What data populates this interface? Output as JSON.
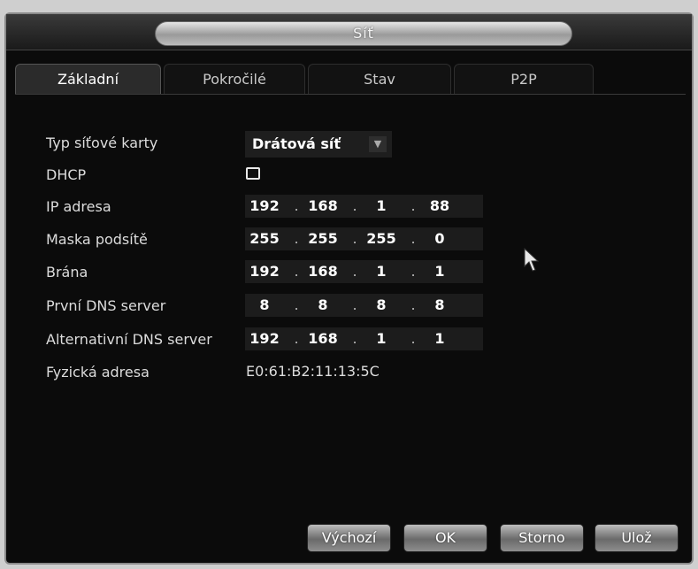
{
  "window": {
    "title": "Síť"
  },
  "tabs": [
    "Základní",
    "Pokročilé",
    "Stav",
    "P2P"
  ],
  "form": {
    "nic_type_label": "Typ síťové karty",
    "nic_type_value": "Drátová síť",
    "dhcp_label": "DHCP",
    "dhcp_checked": false,
    "ip_label": "IP adresa",
    "ip": [
      "192",
      "168",
      "1",
      "88"
    ],
    "mask_label": "Maska podsítě",
    "mask": [
      "255",
      "255",
      "255",
      "0"
    ],
    "gateway_label": "Brána",
    "gateway": [
      "192",
      "168",
      "1",
      "1"
    ],
    "dns1_label": "První DNS server",
    "dns1": [
      "8",
      "8",
      "8",
      "8"
    ],
    "dns2_label": "Alternativní DNS server",
    "dns2": [
      "192",
      "168",
      "1",
      "1"
    ],
    "mac_label": "Fyzická adresa",
    "mac": "E0:61:B2:11:13:5C"
  },
  "buttons": {
    "default": "Výchozí",
    "ok": "OK",
    "cancel": "Storno",
    "save": "Ulož"
  },
  "icons": {
    "dropdown": "chevron-down-icon",
    "pointer": "mouse-cursor-icon"
  }
}
